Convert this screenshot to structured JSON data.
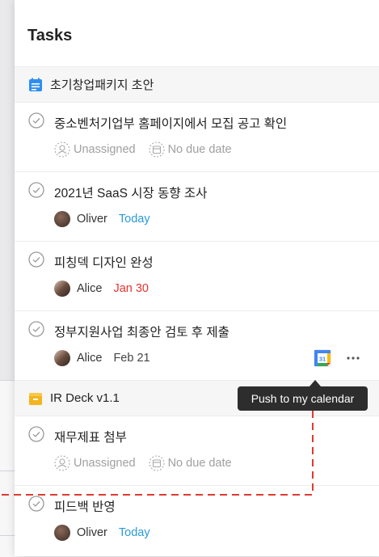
{
  "title": "Tasks",
  "groups": [
    {
      "name": "초기창업패키지 초안",
      "tasks": [
        {
          "title": "중소벤처기업부 홈페이지에서 모집 공고 확인",
          "assignee": "Unassigned",
          "due": "No due date"
        },
        {
          "title": "2021년 SaaS 시장 동향 조사",
          "assignee": "Oliver",
          "due": "Today"
        },
        {
          "title": "피칭덱 디자인 완성",
          "assignee": "Alice",
          "due": "Jan 30"
        },
        {
          "title": "정부지원사업 최종안 검토 후 제출",
          "assignee": "Alice",
          "due": "Feb 21"
        }
      ]
    },
    {
      "name": "IR Deck v1.1",
      "tasks": [
        {
          "title": "재무제표 첨부",
          "assignee": "Unassigned",
          "due": "No due date"
        },
        {
          "title": "피드백 반영",
          "assignee": "Oliver",
          "due": "Today"
        }
      ]
    }
  ],
  "tooltip": "Push to my calendar",
  "calendar_day": "31",
  "colors": {
    "today": "#2a9bd8",
    "overdue": "#e8332d",
    "group1_icon": "#2f8ef0",
    "group2_icon": "#f3b51e",
    "dashed_line": "#e03a2f"
  }
}
